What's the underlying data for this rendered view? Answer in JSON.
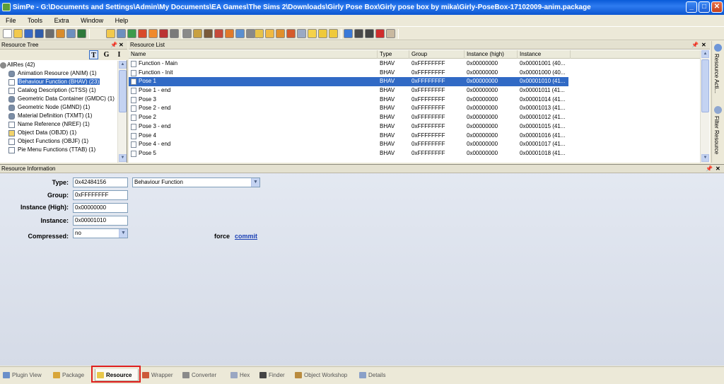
{
  "window": {
    "title": "SimPe - G:\\Documents and Settings\\Admin\\My Documents\\EA Games\\The Sims 2\\Downloads\\Girly Pose Box\\Girly pose box by mika\\Girly-PoseBox-17102009-anim.package"
  },
  "menu": [
    "File",
    "Tools",
    "Extra",
    "Window",
    "Help"
  ],
  "tree": {
    "header": "Resource Tree",
    "buttons": [
      "T",
      "G",
      "I"
    ],
    "root": "AllRes (42)",
    "items": [
      {
        "label": "Animation Resource (ANIM) (1)",
        "icon": "cylinder"
      },
      {
        "label": "Behaviour Function (BHAV) (23)",
        "icon": "document",
        "selected": true
      },
      {
        "label": "Catalog Description (CTSS) (1)",
        "icon": "document"
      },
      {
        "label": "Geometric Data Container (GMDC) (1)",
        "icon": "cylinder"
      },
      {
        "label": "Geometric Node (GMND) (1)",
        "icon": "cylinder"
      },
      {
        "label": "Material Definition (TXMT) (1)",
        "icon": "cylinder"
      },
      {
        "label": "Name Reference (NREF) (1)",
        "icon": "document"
      },
      {
        "label": "Object Data (OBJD) (1)",
        "icon": "folder"
      },
      {
        "label": "Object Functions (OBJF) (1)",
        "icon": "document"
      },
      {
        "label": "Pie Menu Functions (TTAB) (1)",
        "icon": "document"
      }
    ]
  },
  "list": {
    "header": "Resource List",
    "columns": [
      "Name",
      "Type",
      "Group",
      "Instance (high)",
      "Instance"
    ],
    "rows": [
      [
        "Function - Main",
        "BHAV",
        "0xFFFFFFFF",
        "0x00000000",
        "0x00001001 (40..."
      ],
      [
        "Function - Init",
        "BHAV",
        "0xFFFFFFFF",
        "0x00000000",
        "0x00001000 (40..."
      ],
      [
        "Pose 1",
        "BHAV",
        "0xFFFFFFFF",
        "0x00000000",
        "0x00001010 (41..."
      ],
      [
        "Pose 1 - end",
        "BHAV",
        "0xFFFFFFFF",
        "0x00000000",
        "0x00001011 (41..."
      ],
      [
        "Pose 3",
        "BHAV",
        "0xFFFFFFFF",
        "0x00000000",
        "0x00001014 (41..."
      ],
      [
        "Pose 2 - end",
        "BHAV",
        "0xFFFFFFFF",
        "0x00000000",
        "0x00001013 (41..."
      ],
      [
        "Pose 2",
        "BHAV",
        "0xFFFFFFFF",
        "0x00000000",
        "0x00001012 (41..."
      ],
      [
        "Pose 3 - end",
        "BHAV",
        "0xFFFFFFFF",
        "0x00000000",
        "0x00001015 (41..."
      ],
      [
        "Pose 4",
        "BHAV",
        "0xFFFFFFFF",
        "0x00000000",
        "0x00001016 (41..."
      ],
      [
        "Pose 4 - end",
        "BHAV",
        "0xFFFFFFFF",
        "0x00000000",
        "0x00001017 (41..."
      ],
      [
        "Pose 5",
        "BHAV",
        "0xFFFFFFFF",
        "0x00000000",
        "0x00001018 (41..."
      ]
    ],
    "selected_row": 2
  },
  "side_tabs": [
    "Resource Acti...",
    "Filter Resource"
  ],
  "info": {
    "header": "Resource Information",
    "type_label": "Type:",
    "type_value": "0x42484156",
    "type_name": "Behaviour Function",
    "group_label": "Group:",
    "group_value": "0xFFFFFFFF",
    "inst_high_label": "Instance (High):",
    "inst_high_value": "0x00000000",
    "instance_label": "Instance:",
    "instance_value": "0x00001010",
    "compressed_label": "Compressed:",
    "compressed_value": "no",
    "force_text": "force",
    "commit_link": "commit"
  },
  "bottom_tabs": [
    {
      "label": "Plugin View",
      "color": "#6a8fc9"
    },
    {
      "label": "Package",
      "color": "#d8a63a"
    },
    {
      "label": "Resource",
      "color": "#e8c74a",
      "active": true
    },
    {
      "label": "Wrapper",
      "color": "#cc5a3a"
    },
    {
      "label": "Converter",
      "color": "#8a8a8a"
    },
    {
      "label": "Hex",
      "color": "#9aa7c2"
    },
    {
      "label": "Finder",
      "color": "#444444"
    },
    {
      "label": "Object Workshop",
      "color": "#b98b3e"
    },
    {
      "label": "Details",
      "color": "#8aa0c8"
    }
  ]
}
